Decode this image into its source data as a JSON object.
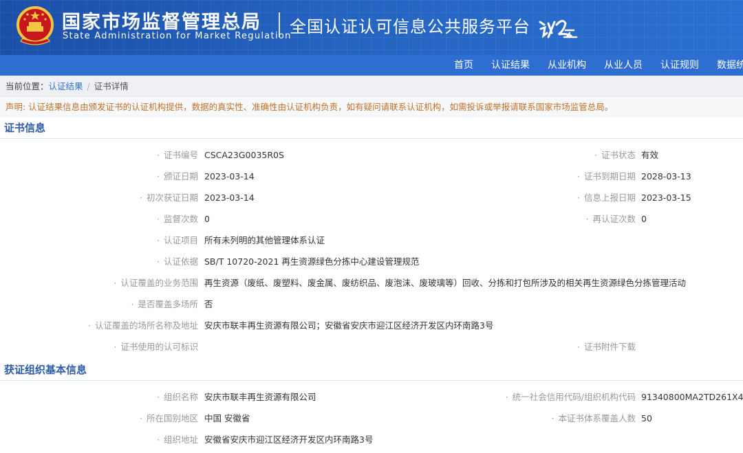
{
  "header": {
    "agency_cn": "国家市场监督管理总局",
    "agency_en": "State Administration  for  Market Regulation",
    "platform_title": "全国认证认可信息公共服务平台",
    "platform_logo_text": "认云",
    "brand_color": "#1b4fa8"
  },
  "nav": {
    "items": [
      "首页",
      "认证结果",
      "从业机构",
      "从业人员",
      "认证规则",
      "数据统"
    ]
  },
  "breadcrumb": {
    "prefix": "当前位置：",
    "link": "认证结果",
    "separator": "/",
    "current": "证书详情"
  },
  "notice": "声明: 认证结果信息由颁发证书的认证机构提供，数据的真实性、准确性由认证机构负责，如有疑问请联系认证机构，如需投诉或举报请联系国家市场监管总局。",
  "cert_section": {
    "title": "证书信息",
    "rows": [
      {
        "l1": "证书编号",
        "v1": "CSCA23G0035R0S",
        "l2": "证书状态",
        "v2": "有效"
      },
      {
        "l1": "颁证日期",
        "v1": "2023-03-14",
        "l2": "证书到期日期",
        "v2": "2028-03-13"
      },
      {
        "l1": "初次获证日期",
        "v1": "2023-03-14",
        "l2": "信息上报日期",
        "v2": "2023-03-15"
      },
      {
        "l1": "监督次数",
        "v1": "0",
        "l2": "再认证次数",
        "v2": "0"
      },
      {
        "l1": "认证项目",
        "v1": "所有未列明的其他管理体系认证"
      },
      {
        "l1": "认证依据",
        "v1": "SB/T 10720-2021 再生资源绿色分拣中心建设管理规范"
      },
      {
        "l1": "认证覆盖的业务范围",
        "v1": "再生资源（废纸、废塑料、废金属、废纺织品、废泡沫、废玻璃等）回收、分拣和打包所涉及的相关再生资源绿色分拣管理活动"
      },
      {
        "l1": "是否覆盖多场所",
        "v1": "否"
      },
      {
        "l1": "认证覆盖的场所名称及地址",
        "v1": "安庆市联丰再生资源有限公司；安徽省安庆市迎江区经济开发区内环南路3号"
      },
      {
        "l1": "证书使用的认可标识",
        "v1": "",
        "l2": "证书附件下载",
        "v2": ""
      }
    ]
  },
  "org_section": {
    "title": "获证组织基本信息",
    "rows": [
      {
        "l1": "组织名称",
        "v1": "安庆市联丰再生资源有限公司",
        "l2": "统一社会信用代码/组织机构代码",
        "v2": "91340800MA2TD261X4"
      },
      {
        "l1": "所在国别地区",
        "v1": "中国 安徽省",
        "l2": "本证书体系覆盖人数",
        "v2": "50"
      },
      {
        "l1": "组织地址",
        "v1": "安徽省安庆市迎江区经济开发区内环南路3号"
      }
    ]
  }
}
